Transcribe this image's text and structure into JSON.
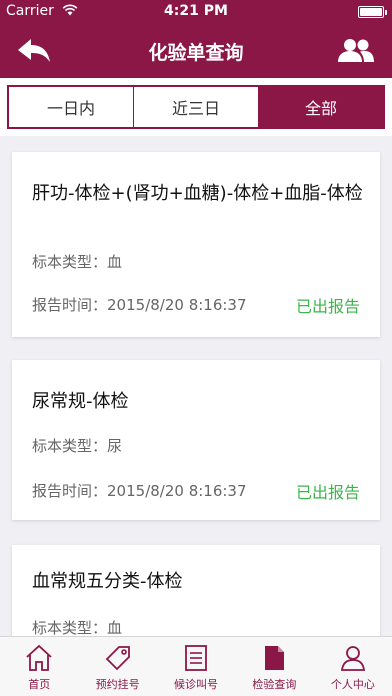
{
  "status_bar": {
    "carrier": "Carrier",
    "time": "4:21 PM"
  },
  "nav": {
    "title": "化验单查询",
    "back_icon": "back-arrow-icon",
    "users_icon": "users-icon"
  },
  "segments": [
    {
      "label": "一日内",
      "active": false
    },
    {
      "label": "近三日",
      "active": false
    },
    {
      "label": "全部",
      "active": true
    }
  ],
  "results": [
    {
      "title": "肝功-体检+(肾功+血糖)-体检+血脂-体检",
      "type_label": "标本类型：",
      "type": "血",
      "time_label": "报告时间：",
      "time": "2015/8/20 8:16:37",
      "status": "已出报告"
    },
    {
      "title": "尿常规-体检",
      "type_label": "标本类型：",
      "type": "尿",
      "time_label": "报告时间：",
      "time": "2015/8/20 8:16:37",
      "status": "已出报告"
    },
    {
      "title": "血常规五分类-体检",
      "type_label": "标本类型：",
      "type": "血",
      "time_label": "",
      "time": "",
      "status": ""
    }
  ],
  "status_color": "#3cb54a",
  "accent_color": "#8b1747",
  "tabs": [
    {
      "label": "首页",
      "icon": "home-icon"
    },
    {
      "label": "预约挂号",
      "icon": "tag-icon"
    },
    {
      "label": "候诊叫号",
      "icon": "list-icon"
    },
    {
      "label": "检验查询",
      "icon": "document-icon"
    },
    {
      "label": "个人中心",
      "icon": "person-icon"
    }
  ]
}
